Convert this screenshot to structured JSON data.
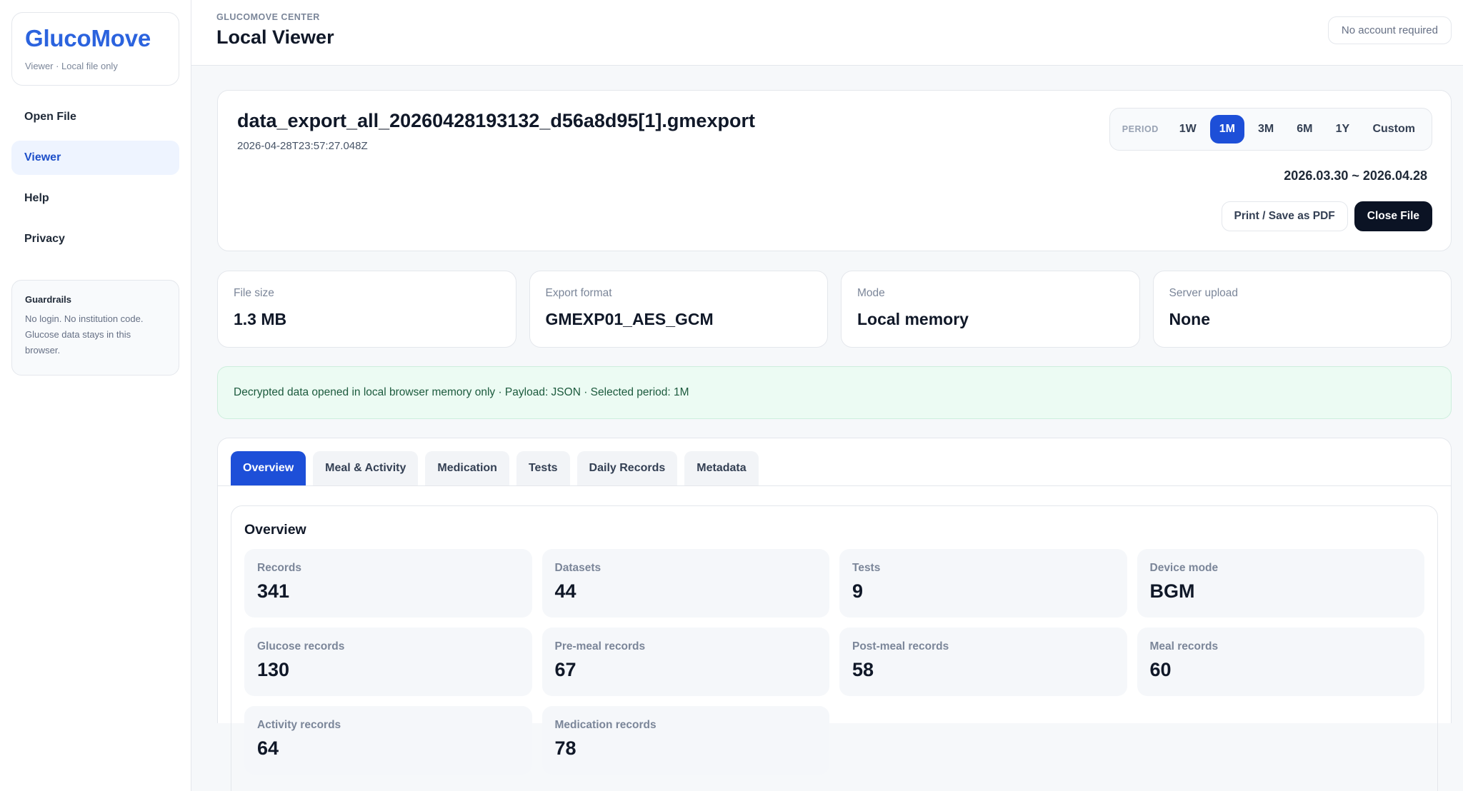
{
  "sidebar": {
    "brand": "GlucoMove",
    "brand_sub": "Viewer · Local file only",
    "nav": [
      {
        "label": "Open File"
      },
      {
        "label": "Viewer"
      },
      {
        "label": "Help"
      },
      {
        "label": "Privacy"
      }
    ],
    "guardrails": {
      "title": "Guardrails",
      "text": "No login. No institution code. Glucose data stays in this browser."
    }
  },
  "header": {
    "eyebrow": "GLUCOMOVE CENTER",
    "title": "Local Viewer",
    "account_badge": "No account required"
  },
  "file": {
    "name": "data_export_all_20260428193132_d56a8d95[1].gmexport",
    "timestamp": "2026-04-28T23:57:27.048Z",
    "period_label": "PERIOD",
    "periods": [
      "1W",
      "1M",
      "3M",
      "6M",
      "1Y",
      "Custom"
    ],
    "selected_period": "1M",
    "date_range": "2026.03.30 ~ 2026.04.28",
    "print_label": "Print / Save as PDF",
    "close_label": "Close File"
  },
  "stats": [
    {
      "label": "File size",
      "value": "1.3 MB"
    },
    {
      "label": "Export format",
      "value": "GMEXP01_AES_GCM"
    },
    {
      "label": "Mode",
      "value": "Local memory"
    },
    {
      "label": "Server upload",
      "value": "None"
    }
  ],
  "notice": "Decrypted data opened in local browser memory only · Payload: JSON · Selected period: 1M",
  "tabs": [
    "Overview",
    "Meal & Activity",
    "Medication",
    "Tests",
    "Daily Records",
    "Metadata"
  ],
  "active_tab": "Overview",
  "overview": {
    "title": "Overview",
    "metrics": [
      {
        "label": "Records",
        "value": "341"
      },
      {
        "label": "Datasets",
        "value": "44"
      },
      {
        "label": "Tests",
        "value": "9"
      },
      {
        "label": "Device mode",
        "value": "BGM"
      },
      {
        "label": "Glucose records",
        "value": "130"
      },
      {
        "label": "Pre-meal records",
        "value": "67"
      },
      {
        "label": "Post-meal records",
        "value": "58"
      },
      {
        "label": "Meal records",
        "value": "60"
      },
      {
        "label": "Activity records",
        "value": "64"
      },
      {
        "label": "Medication records",
        "value": "78"
      }
    ]
  }
}
